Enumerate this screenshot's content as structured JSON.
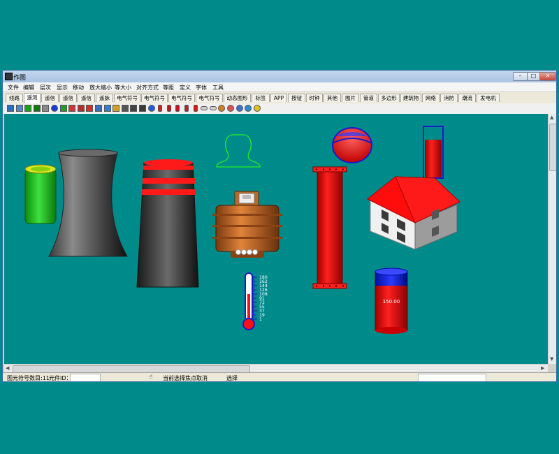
{
  "window": {
    "title": "作图"
  },
  "menu": [
    "文件",
    "编辑",
    "层次",
    "显示",
    "移动",
    "放大缩小",
    "等大小",
    "对齐方式",
    "等距",
    "定义",
    "字体",
    "工具"
  ],
  "tabs": [
    {
      "label": "线路"
    },
    {
      "label": "遥测"
    },
    {
      "label": "遥信"
    },
    {
      "label": "遥信"
    },
    {
      "label": "遥信"
    },
    {
      "label": "遥脉"
    },
    {
      "label": "电气符号"
    },
    {
      "label": "电气符号"
    },
    {
      "label": "电气符号"
    },
    {
      "label": "电气符号"
    },
    {
      "label": "动态图形"
    },
    {
      "label": "标签"
    },
    {
      "label": "APP"
    },
    {
      "label": "按钮"
    },
    {
      "label": "时钟"
    },
    {
      "label": "其他"
    },
    {
      "label": "图片"
    },
    {
      "label": "管道"
    },
    {
      "label": "多边形"
    },
    {
      "label": "建筑物"
    },
    {
      "label": "网络"
    },
    {
      "label": "消防"
    },
    {
      "label": "潮流"
    },
    {
      "label": "发电机"
    }
  ],
  "active_tab_index": 1,
  "toolbar_icons": [
    {
      "name": "image-icon",
      "color": "#2a6fbf"
    },
    {
      "name": "image-icon",
      "color": "#5a86c8"
    },
    {
      "name": "cylinder-icon",
      "color": "#1aa01a"
    },
    {
      "name": "cylinder-icon",
      "color": "#117711"
    },
    {
      "name": "bar-icon",
      "color": "#8a8a8a"
    },
    {
      "name": "circle-icon",
      "color": "#1a3dd1"
    },
    {
      "name": "bar-icon",
      "color": "#2a9a2a"
    },
    {
      "name": "grid-icon",
      "color": "#c43a3a"
    },
    {
      "name": "cube-icon",
      "color": "#b03030"
    },
    {
      "name": "diamond-icon",
      "color": "#d23030"
    },
    {
      "name": "gear-icon",
      "color": "#3a6fc0"
    },
    {
      "name": "bar-chart-icon",
      "color": "#3a7ad0"
    },
    {
      "name": "bar-chart-icon",
      "color": "#d2a020"
    },
    {
      "name": "panel-icon",
      "color": "#555555"
    },
    {
      "name": "keyboard-icon",
      "color": "#444444"
    },
    {
      "name": "monitor-icon",
      "color": "#3a3a3a"
    },
    {
      "name": "gauge-icon",
      "color": "#2060d0"
    },
    {
      "name": "tank-icon",
      "color": "#d02020"
    },
    {
      "name": "tank-icon",
      "color": "#c01818"
    },
    {
      "name": "tank-icon",
      "color": "#c01818"
    },
    {
      "name": "pipe-icon",
      "color": "#d01a1a"
    },
    {
      "name": "pipe-icon",
      "color": "#d01a1a"
    },
    {
      "name": "bulb-icon",
      "color": "#cfcfcf"
    },
    {
      "name": "bulb-icon",
      "color": "#cfcfcf"
    },
    {
      "name": "ball-icon",
      "color": "#d08020"
    },
    {
      "name": "ball-icon",
      "color": "#e05050"
    },
    {
      "name": "pie-icon",
      "color": "#4070d0"
    },
    {
      "name": "clock-icon",
      "color": "#2a8ad0"
    },
    {
      "name": "face-icon",
      "color": "#e0c020"
    }
  ],
  "canvas": {
    "thermometer_ticks": [
      "180",
      "162",
      "144",
      "126",
      "108",
      "91",
      "73",
      "55",
      "37",
      "19",
      "1"
    ],
    "tank_value": "150.00"
  },
  "status": {
    "count_label": "图元符号数目:11",
    "id_label": "元件ID：",
    "id_value": "",
    "cancel_label": "当前选择焦点取消",
    "mode_label": "选择",
    "right_value": ""
  }
}
